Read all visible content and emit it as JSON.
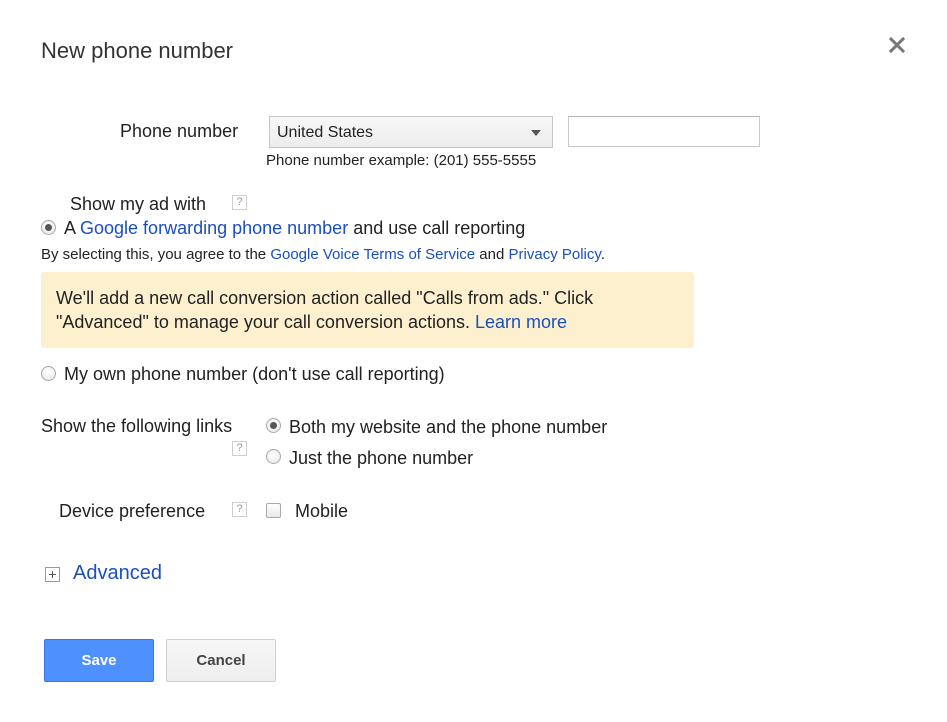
{
  "dialog": {
    "title": "New phone number",
    "close_icon": "close-icon"
  },
  "phone": {
    "label": "Phone number",
    "country_selected": "United States",
    "number_value": "",
    "example": "Phone number example: (201) 555-5555"
  },
  "show_ad": {
    "label": "Show my ad with",
    "help": "?",
    "option_forwarding": {
      "prefix": "A ",
      "link": "Google forwarding phone number",
      "suffix": " and use call reporting",
      "checked": true
    },
    "terms": {
      "prefix": "By selecting this, you agree to the ",
      "tos_link": "Google Voice Terms of Service",
      "middle": " and ",
      "privacy_link": "Privacy Policy",
      "suffix": "."
    },
    "notice": {
      "text": "We'll add a new call conversion action called \"Calls from ads.\" Click \"Advanced\" to manage your call conversion actions. ",
      "link": "Learn more",
      "background": "#fdf0cf"
    },
    "option_own": {
      "label": "My own phone number (don't use call reporting)",
      "checked": false
    }
  },
  "links": {
    "label": "Show the following links",
    "help": "?",
    "option_both": {
      "label": "Both my website and the phone number",
      "checked": true
    },
    "option_phone": {
      "label": "Just the phone number",
      "checked": false
    }
  },
  "device": {
    "label": "Device preference",
    "help": "?",
    "mobile_label": "Mobile",
    "mobile_checked": false
  },
  "advanced": {
    "label": "Advanced",
    "icon": "expand-icon"
  },
  "buttons": {
    "save": "Save",
    "cancel": "Cancel"
  },
  "colors": {
    "link": "#1a4fbd",
    "primary_button": "#4d90fe",
    "notice_bg": "#fdf0cf"
  }
}
